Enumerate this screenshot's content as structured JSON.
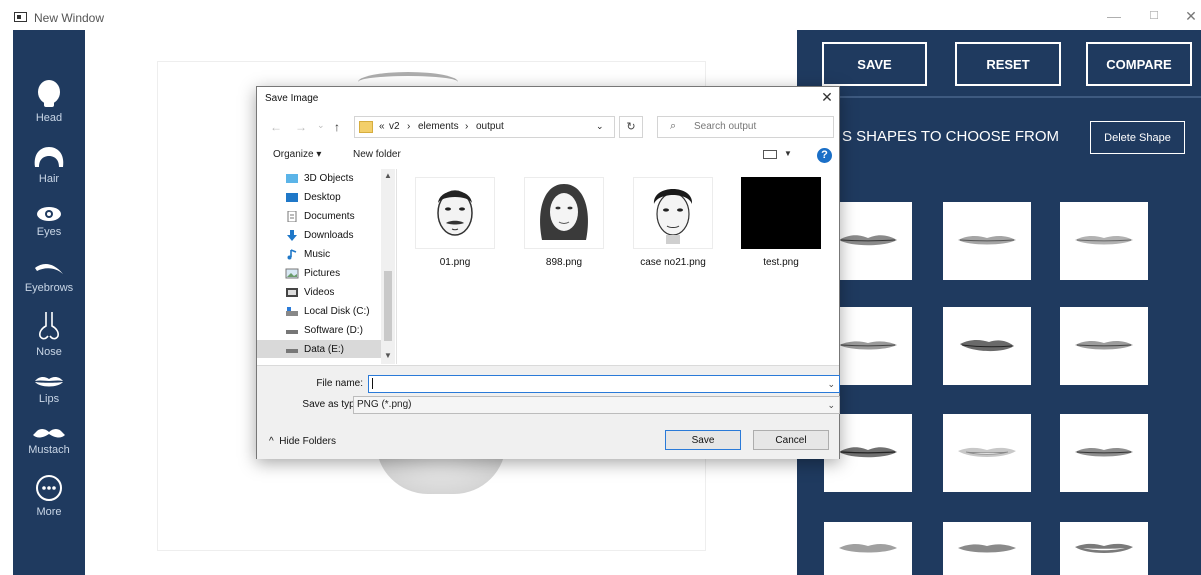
{
  "window": {
    "title": "New Window",
    "min": "—",
    "max": "☐",
    "close": "✕"
  },
  "sidebar": {
    "items": [
      {
        "label": "Head",
        "icon": "head-icon"
      },
      {
        "label": "Hair",
        "icon": "hair-icon"
      },
      {
        "label": "Eyes",
        "icon": "eye-icon"
      },
      {
        "label": "Eyebrows",
        "icon": "eyebrow-icon"
      },
      {
        "label": "Nose",
        "icon": "nose-icon"
      },
      {
        "label": "Lips",
        "icon": "lips-icon"
      },
      {
        "label": "Mustach",
        "icon": "mustache-icon"
      },
      {
        "label": "More",
        "icon": "more-icon"
      }
    ]
  },
  "toolbar": {
    "save": "SAVE",
    "reset": "RESET",
    "compare": "COMPARE"
  },
  "shapes_panel": {
    "heading": "S SHAPES TO CHOOSE FROM",
    "delete_button": "Delete Shape",
    "tile_count_visible": 12
  },
  "dialog": {
    "title": "Save Image",
    "close": "✕",
    "nav": {
      "back": "←",
      "forward": "→",
      "recent": "⌄",
      "up": "↑"
    },
    "address": {
      "prefix": "«",
      "crumbs": [
        "v2",
        "elements",
        "output"
      ],
      "sep": "›",
      "dropdown": "⌄"
    },
    "refresh": "↻",
    "search_placeholder": "Search output",
    "organize": "Organize ▾",
    "new_folder": "New folder",
    "help": "?",
    "nav_items": [
      {
        "label": "3D Objects",
        "icon": "3d-objects-icon"
      },
      {
        "label": "Desktop",
        "icon": "desktop-icon"
      },
      {
        "label": "Documents",
        "icon": "documents-icon"
      },
      {
        "label": "Downloads",
        "icon": "downloads-icon"
      },
      {
        "label": "Music",
        "icon": "music-icon"
      },
      {
        "label": "Pictures",
        "icon": "pictures-icon"
      },
      {
        "label": "Videos",
        "icon": "videos-icon"
      },
      {
        "label": "Local Disk (C:)",
        "icon": "local-disk-icon"
      },
      {
        "label": "Software (D:)",
        "icon": "drive-icon"
      },
      {
        "label": "Data (E:)",
        "icon": "drive-icon"
      }
    ],
    "files": [
      {
        "name": "01.png"
      },
      {
        "name": "898.png"
      },
      {
        "name": "case no21.png"
      },
      {
        "name": "test.png"
      }
    ],
    "file_name_label": "File name:",
    "file_name_value": "",
    "save_type_label": "Save as type:",
    "save_type_value": "PNG (*.png)",
    "hide_folders": "Hide Folders",
    "save_button": "Save",
    "cancel_button": "Cancel"
  },
  "colors": {
    "navy": "#1f3a5f",
    "accent": "#2a7ad8"
  }
}
